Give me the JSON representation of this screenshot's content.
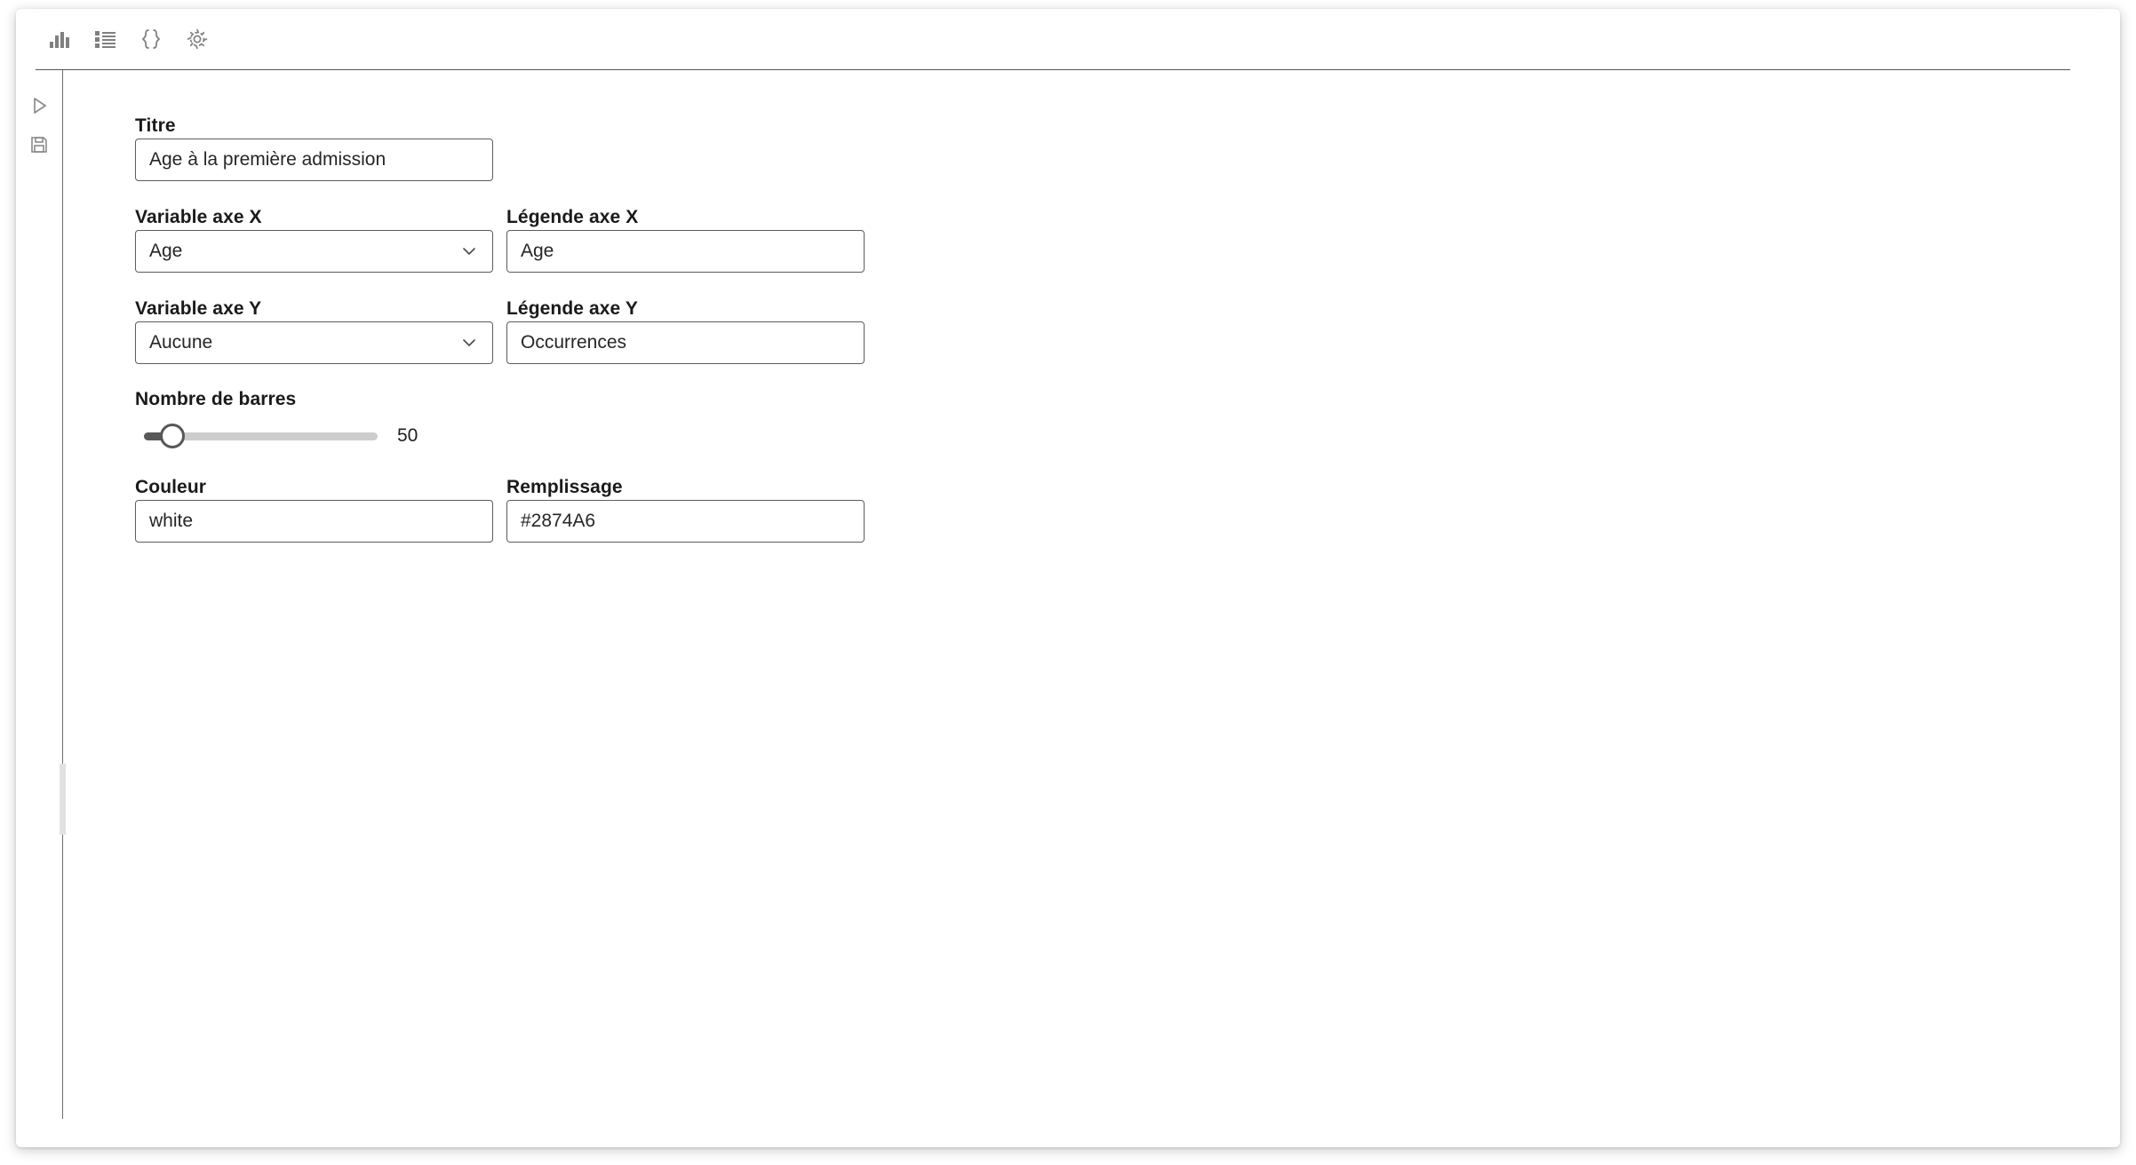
{
  "toolbar": {
    "buttons": [
      {
        "name": "chart-view",
        "icon": "bar-chart-icon"
      },
      {
        "name": "list-view",
        "icon": "list-icon"
      },
      {
        "name": "code-view",
        "icon": "curly-braces-icon"
      },
      {
        "name": "settings-view",
        "icon": "gear-icon"
      }
    ]
  },
  "rail": {
    "buttons": [
      {
        "name": "run",
        "icon": "play-icon"
      },
      {
        "name": "save",
        "icon": "save-floppy-icon"
      }
    ]
  },
  "form": {
    "title": {
      "label": "Titre",
      "value": "Age à la première admission"
    },
    "x_variable": {
      "label": "Variable axe X",
      "value": "Age"
    },
    "x_legend": {
      "label": "Légende axe X",
      "value": "Age"
    },
    "y_variable": {
      "label": "Variable axe Y",
      "value": "Aucune"
    },
    "y_legend": {
      "label": "Légende axe Y",
      "value": "Occurrences"
    },
    "bars": {
      "label": "Nombre de barres",
      "value": "50"
    },
    "color": {
      "label": "Couleur",
      "value": "white"
    },
    "fill": {
      "label": "Remplissage",
      "value": "#2874A6"
    }
  },
  "colors": {
    "fill_swatch": "#2874A6",
    "border": "#5c5c5c",
    "icon": "#808080",
    "slider_fill": "#585858",
    "slider_track": "#cdcdcd"
  }
}
